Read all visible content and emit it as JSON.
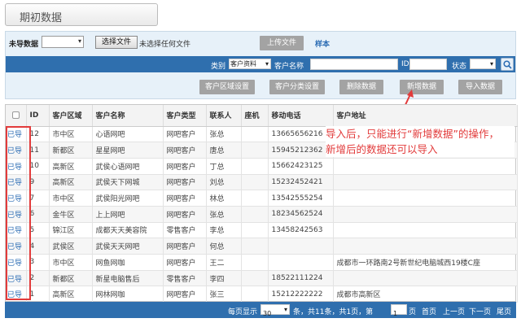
{
  "title": "期初数据",
  "upload": {
    "label": "未导数据",
    "file_button": "选择文件",
    "file_text": "未选择任何文件",
    "upload_button": "上传文件",
    "sample_link": "样本"
  },
  "filter": {
    "category_label": "类别",
    "category_value": "客户资料",
    "name_label": "客户名称",
    "id_label": "ID",
    "status_label": "状态",
    "search_icon": "search-icon"
  },
  "actions": {
    "region_settings": "客户区域设置",
    "category_settings": "客户分类设置",
    "delete": "删除数据",
    "add": "新增数据",
    "import": "导入数据"
  },
  "table": {
    "headers": [
      "ID",
      "客户区域",
      "客户名称",
      "客户类型",
      "联系人",
      "座机",
      "移动电话",
      "客户地址"
    ],
    "rows": [
      {
        "status": "已导",
        "id": "12",
        "region": "市中区",
        "name": "心语网吧",
        "type": "网吧客户",
        "contact": "张总",
        "phone": "",
        "mobile": "13665656216",
        "address": ""
      },
      {
        "status": "已导",
        "id": "11",
        "region": "新都区",
        "name": "星星网吧",
        "type": "网吧客户",
        "contact": "唐总",
        "phone": "",
        "mobile": "15945212362",
        "address": ""
      },
      {
        "status": "已导",
        "id": "10",
        "region": "高新区",
        "name": "武侯心语网吧",
        "type": "网吧客户",
        "contact": "丁总",
        "phone": "",
        "mobile": "15662423125",
        "address": ""
      },
      {
        "status": "已导",
        "id": "9",
        "region": "高新区",
        "name": "武侯天下网城",
        "type": "网吧客户",
        "contact": "刘总",
        "phone": "",
        "mobile": "15232452421",
        "address": ""
      },
      {
        "status": "已导",
        "id": "7",
        "region": "市中区",
        "name": "武侯阳光网吧",
        "type": "网吧客户",
        "contact": "林总",
        "phone": "",
        "mobile": "13542555254",
        "address": ""
      },
      {
        "status": "已导",
        "id": "6",
        "region": "金牛区",
        "name": "上上网吧",
        "type": "网吧客户",
        "contact": "张总",
        "phone": "",
        "mobile": "18234562524",
        "address": ""
      },
      {
        "status": "已导",
        "id": "5",
        "region": "锦江区",
        "name": "成都天天美容院",
        "type": "零售客户",
        "contact": "李总",
        "phone": "",
        "mobile": "13458242563",
        "address": ""
      },
      {
        "status": "已导",
        "id": "4",
        "region": "武侯区",
        "name": "武侯天天网吧",
        "type": "网吧客户",
        "contact": "何总",
        "phone": "",
        "mobile": "",
        "address": ""
      },
      {
        "status": "已导",
        "id": "3",
        "region": "市中区",
        "name": "网鱼网咖",
        "type": "网吧客户",
        "contact": "王二",
        "phone": "",
        "mobile": "",
        "address": "成都市一环路南2号新世纪电脑城西19楼C座"
      },
      {
        "status": "已导",
        "id": "2",
        "region": "新都区",
        "name": "新星电脑售后",
        "type": "零售客户",
        "contact": "李四",
        "phone": "",
        "mobile": "18522111224",
        "address": ""
      },
      {
        "status": "已导",
        "id": "1",
        "region": "高新区",
        "name": "网林网咖",
        "type": "网吧客户",
        "contact": "张三",
        "phone": "",
        "mobile": "15212222222",
        "address": "成都市高新区"
      }
    ]
  },
  "annotation": {
    "line1": "导入后，只能进行“新增数据”的操作，",
    "line2": "新增后的数据还可以导入"
  },
  "pagination": {
    "per_page_label": "每页显示",
    "per_page_value": "30",
    "summary_a": "条，共11条，共1页，第",
    "page_value": "1",
    "summary_b": "页",
    "first": "首页",
    "prev": "上一页",
    "next": "下一页",
    "last": "尾页"
  },
  "colors": {
    "bar_blue": "#2f6fae",
    "panel_bg": "#e7f1f9",
    "annotation_red": "#e23b3b",
    "button_gray": "#a3a3a3"
  }
}
